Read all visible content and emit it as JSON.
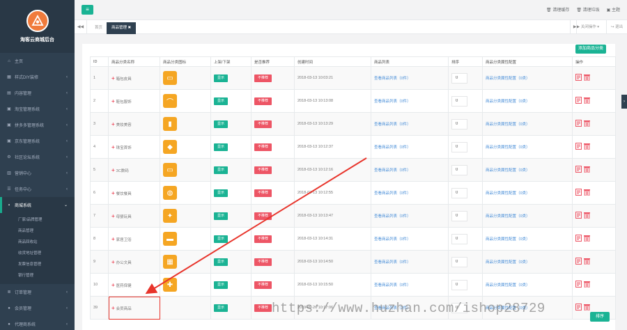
{
  "sidebar": {
    "logo_title": "淘客云商城后台",
    "items": [
      {
        "icon": "home-icon",
        "label": "主页",
        "has_children": false
      },
      {
        "icon": "grid-icon",
        "label": "样式DIY装修",
        "has_children": true
      },
      {
        "icon": "folder-icon",
        "label": "内容管理",
        "has_children": true
      },
      {
        "icon": "shop-icon",
        "label": "淘宝管理系统",
        "has_children": true
      },
      {
        "icon": "shop-icon",
        "label": "拼多多管理系统",
        "has_children": true
      },
      {
        "icon": "shop-icon",
        "label": "京东管理系统",
        "has_children": true
      },
      {
        "icon": "gear-icon",
        "label": "社区论坛系统",
        "has_children": true
      },
      {
        "icon": "chart-icon",
        "label": "营销中心",
        "has_children": true
      },
      {
        "icon": "task-icon",
        "label": "任务中心",
        "has_children": true
      },
      {
        "icon": "cart-icon",
        "label": "商城系统",
        "has_children": true,
        "active": true
      },
      {
        "icon": "list-icon",
        "label": "订单管理",
        "has_children": true
      },
      {
        "icon": "user-icon",
        "label": "会员管理",
        "has_children": true
      },
      {
        "icon": "user-icon",
        "label": "代理商系统",
        "has_children": true
      }
    ],
    "subitems": [
      "厂家/品牌管理",
      "商品管理",
      "商品回收站",
      "收货地址管理",
      "发票信息管理",
      "银行管理"
    ]
  },
  "topbar": {
    "links": [
      "清理缓存",
      "清理垃圾",
      "主题"
    ]
  },
  "tabs": {
    "items": [
      {
        "label": "首页",
        "active": false
      },
      {
        "label": "商品管理",
        "active": true
      }
    ],
    "close_label": "关闭操作",
    "back_label": "退出"
  },
  "panel": {
    "add_button": "添加商品分类",
    "sort_button": "排序",
    "columns": [
      "ID",
      "商品分类名称",
      "商品分类图标",
      "上架/下架",
      "是否推荐",
      "创建时间",
      "商品列表",
      "排序",
      "商品分类属性配置",
      "操作"
    ],
    "rows": [
      {
        "id": "1",
        "name": "箱包皮具",
        "icon": "bag-icon",
        "status": "显示",
        "recommend": "不推荐",
        "created": "2018-03-13 10:03:21",
        "list_link": "查看商品列表（0件）",
        "sort": "0",
        "attr_link": "商品分类属性配置（0类）"
      },
      {
        "id": "2",
        "name": "鞋包服饰",
        "icon": "shoe-icon",
        "status": "显示",
        "recommend": "不推荐",
        "created": "2018-03-13 10:13:08",
        "list_link": "查看商品列表（0件）",
        "sort": "0",
        "attr_link": "商品分类属性配置（0类）"
      },
      {
        "id": "3",
        "name": "美妆美容",
        "icon": "cosmetic-icon",
        "status": "显示",
        "recommend": "不推荐",
        "created": "2018-03-13 10:13:29",
        "list_link": "查看商品列表（0件）",
        "sort": "0",
        "attr_link": "商品分类属性配置（0类）"
      },
      {
        "id": "4",
        "name": "珠宝首饰",
        "icon": "diamond-icon",
        "status": "显示",
        "recommend": "不推荐",
        "created": "2018-03-13 10:12:37",
        "list_link": "查看商品列表（0件）",
        "sort": "0",
        "attr_link": "商品分类属性配置（0类）"
      },
      {
        "id": "5",
        "name": "3C数码",
        "icon": "laptop-icon",
        "status": "显示",
        "recommend": "不推荐",
        "created": "2018-03-13 10:12:16",
        "list_link": "查看商品列表（0件）",
        "sort": "0",
        "attr_link": "商品分类属性配置（0类）"
      },
      {
        "id": "6",
        "name": "餐饮餐具",
        "icon": "dining-icon",
        "status": "显示",
        "recommend": "不推荐",
        "created": "2018-03-13 10:12:55",
        "list_link": "查看商品列表（0件）",
        "sort": "0",
        "attr_link": "商品分类属性配置（0类）"
      },
      {
        "id": "7",
        "name": "母婴玩具",
        "icon": "baby-icon",
        "status": "显示",
        "recommend": "不推荐",
        "created": "2018-03-13 10:13:47",
        "list_link": "查看商品列表（0件）",
        "sort": "0",
        "attr_link": "商品分类属性配置（0类）"
      },
      {
        "id": "8",
        "name": "家居卫浴",
        "icon": "bath-icon",
        "status": "显示",
        "recommend": "不推荐",
        "created": "2018-03-13 10:14:31",
        "list_link": "查看商品列表（0件）",
        "sort": "0",
        "attr_link": "商品分类属性配置（0类）"
      },
      {
        "id": "9",
        "name": "办公文具",
        "icon": "calculator-icon",
        "status": "显示",
        "recommend": "不推荐",
        "created": "2018-03-13 10:14:50",
        "list_link": "查看商品列表（0件）",
        "sort": "0",
        "attr_link": "商品分类属性配置（0类）"
      },
      {
        "id": "10",
        "name": "医药保健",
        "icon": "medkit-icon",
        "status": "显示",
        "recommend": "不推荐",
        "created": "2018-03-13 10:15:50",
        "list_link": "查看商品列表（0件）",
        "sort": "0",
        "attr_link": "商品分类属性配置（0类）"
      },
      {
        "id": "39",
        "name": "会员商品",
        "icon": "",
        "status": "显示",
        "recommend": "不推荐",
        "created": "2019-09-26 10:17:06",
        "list_link": "查看商品列表（2件）",
        "sort": "0",
        "attr_link": "商品分类属性配置（0类）",
        "highlighted": true
      }
    ]
  },
  "watermark": "https://www.huzhan.com/ishop28729",
  "colors": {
    "sidebar": "#2f4050",
    "accent": "#1ab394",
    "danger": "#ed5565",
    "icon_bg": "#f5a623",
    "annotation": "#e8342b"
  }
}
